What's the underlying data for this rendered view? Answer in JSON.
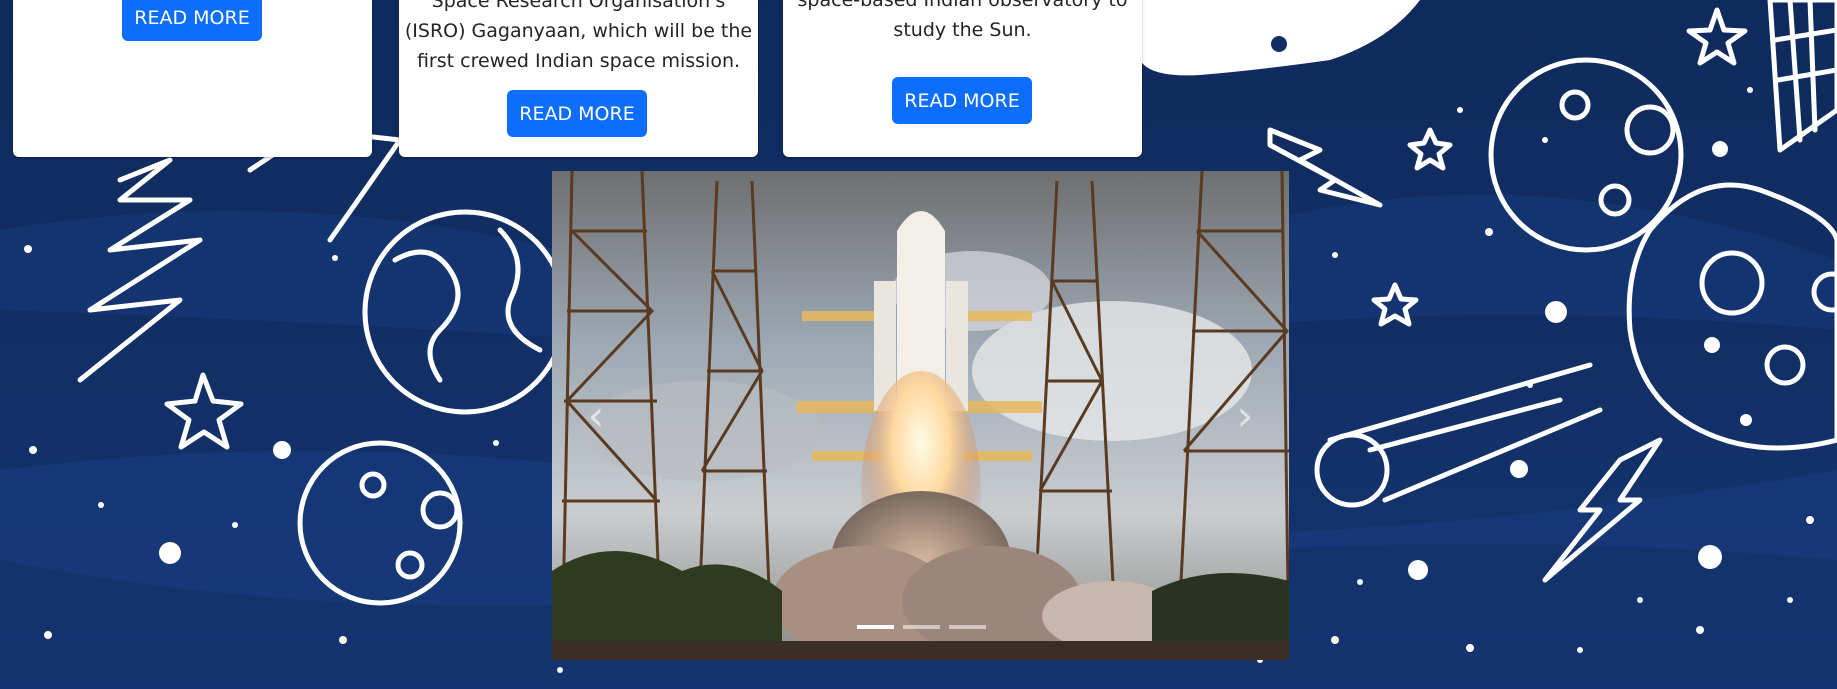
{
  "cards": [
    {
      "button_label": "READ MORE"
    },
    {
      "text_lines": [
        "Space Research Organisation's",
        "(ISRO) Gaganyaan, which will be the",
        "first crewed Indian space mission."
      ],
      "button_label": "READ MORE"
    },
    {
      "text_lines": [
        "space-based Indian observatory to",
        "study the Sun."
      ],
      "button_label": "READ MORE"
    }
  ],
  "carousel": {
    "prev_icon": "chevron-left-icon",
    "next_icon": "chevron-right-icon",
    "prev_glyph": "‹",
    "next_glyph": "›",
    "slide_count": 3,
    "active_slide": 1
  },
  "colors": {
    "background": "#112e63",
    "button": "#0d6efd",
    "card": "#ffffff"
  }
}
